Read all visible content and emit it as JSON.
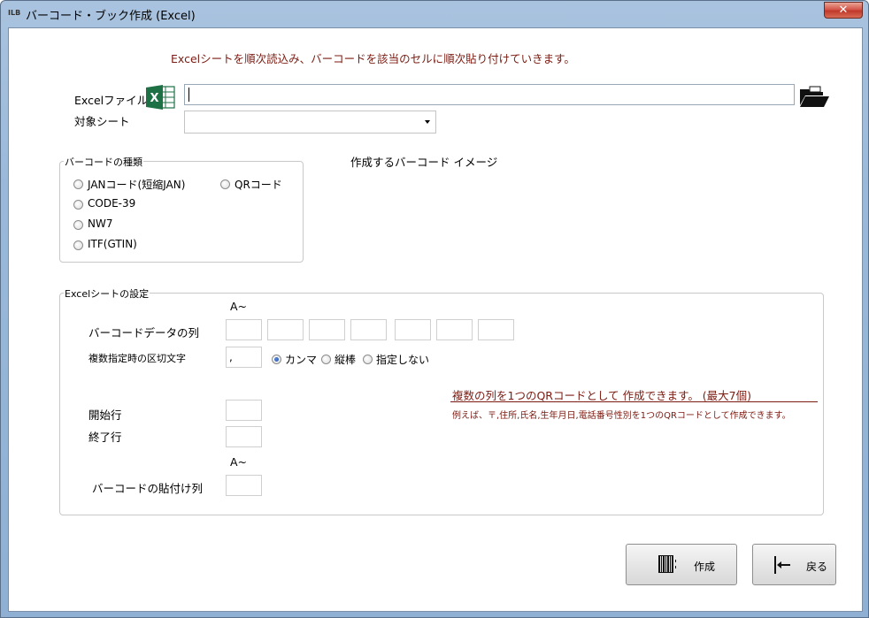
{
  "window": {
    "title": "バーコード・ブック作成 (Excel)",
    "icon_text": "ILB",
    "close_symbol": "✕"
  },
  "intro_text": "Excelシートを順次読込み、バーコードを該当のセルに順次貼り付けていきます。",
  "file": {
    "label": "Excelファイル",
    "value": ""
  },
  "sheet": {
    "label": "対象シート",
    "value": ""
  },
  "barcode_type": {
    "title": "バーコードの種類",
    "options": [
      {
        "label": "JANコード(短縮JAN)",
        "checked": false
      },
      {
        "label": "QRコード",
        "checked": false
      },
      {
        "label": "CODE-39",
        "checked": false
      },
      {
        "label": "NW7",
        "checked": false
      },
      {
        "label": "ITF(GTIN)",
        "checked": false
      }
    ]
  },
  "preview_label": "作成するバーコード イメージ",
  "excel_settings": {
    "title": "Excelシートの設定",
    "col_prefix": "A~",
    "data_col_label": "バーコードデータの列",
    "separator_label": "複数指定時の区切文字",
    "separator_value": ",",
    "separator_options": [
      {
        "label": "カンマ",
        "checked": true
      },
      {
        "label": "縦棒",
        "checked": false
      },
      {
        "label": "指定しない",
        "checked": false
      }
    ],
    "note_main": "複数の列を1つのQRコードとして 作成できます。 (最大7個)",
    "note_sub": "例えば、〒,住所,氏名,生年月日,電話番号性別を1つのQRコードとして作成できます。",
    "start_row_label": "開始行",
    "end_row_label": "終了行",
    "paste_col_prefix": "A~",
    "paste_col_label": "バーコードの貼付け列"
  },
  "buttons": {
    "create": "作成",
    "back": "戻る"
  }
}
